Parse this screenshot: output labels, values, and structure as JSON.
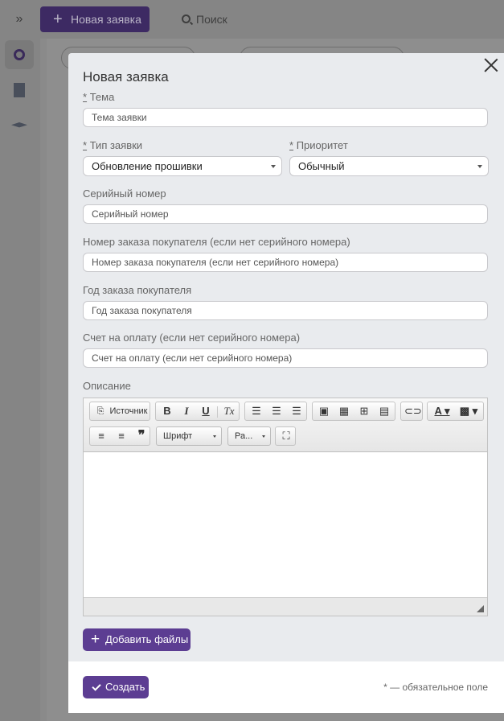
{
  "background_app": {
    "expand_icon": "»",
    "new_request_label": "Новая заявка",
    "search_label": "Поиск"
  },
  "modal": {
    "title": "Новая заявка",
    "fields": {
      "theme": {
        "label": "Тема",
        "required": true,
        "placeholder": "Тема заявки"
      },
      "request_type": {
        "label": "Тип заявки",
        "required": true,
        "value": "Обновление прошивки"
      },
      "priority": {
        "label": "Приоритет",
        "required": true,
        "value": "Обычный"
      },
      "serial": {
        "label": "Серийный номер",
        "placeholder": "Серийный номер"
      },
      "order_number": {
        "label": "Номер заказа покупателя (если нет серийного номера)",
        "placeholder": "Номер заказа покупателя (если нет серийного номера)"
      },
      "order_year": {
        "label": "Год заказа покупателя",
        "placeholder": "Год заказа покупателя"
      },
      "invoice": {
        "label": "Счет на оплату (если нет серийного номера)",
        "placeholder": "Счет на оплату (если нет серийного номера)"
      },
      "description": {
        "label": "Описание"
      }
    },
    "editor": {
      "source_label": "Источник",
      "bold": "B",
      "italic": "I",
      "underline": "U",
      "clear_format": "Tx",
      "font_combo": "Шрифт",
      "size_combo": "Ра..."
    },
    "add_files_label": "Добавить файлы",
    "create_label": "Создать",
    "required_note": "* — обязательное поле",
    "required_mark": "*"
  },
  "colors": {
    "accent": "#5c3d92",
    "overlay": "#8a8a8a"
  }
}
